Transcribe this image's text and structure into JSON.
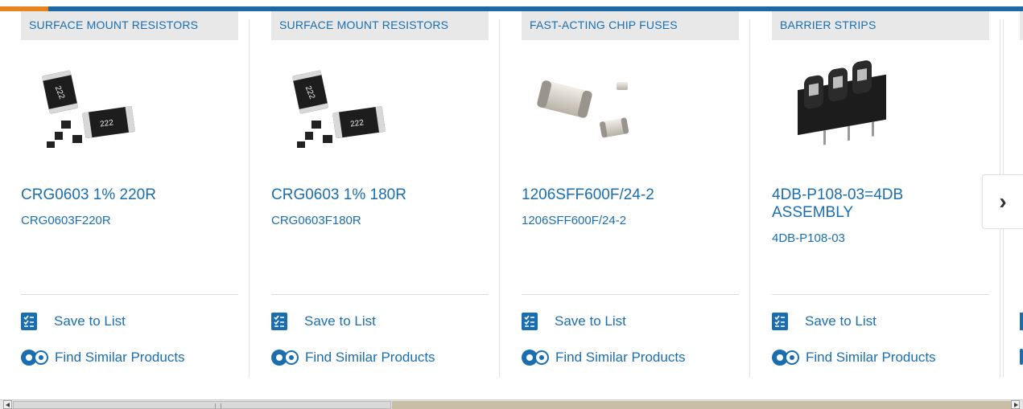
{
  "accent_color": "#1a6eb0",
  "top_accent_colors": {
    "bar": "#1b6aa5",
    "active": "#e9831f"
  },
  "actions": {
    "save": "Save to List",
    "similar": "Find Similar Products"
  },
  "products": [
    {
      "category": "SURFACE MOUNT RESISTORS",
      "name": "CRG0603 1% 220R",
      "part_number": "CRG0603F220R",
      "image": "chip-resistor-icon",
      "resistor_marking": "222"
    },
    {
      "category": "SURFACE MOUNT RESISTORS",
      "name": "CRG0603 1% 180R",
      "part_number": "CRG0603F180R",
      "image": "chip-resistor-icon",
      "resistor_marking": "222"
    },
    {
      "category": "FAST-ACTING CHIP FUSES",
      "name": "1206SFF600F/24-2",
      "part_number": "1206SFF600F/24-2",
      "image": "chip-fuse-icon"
    },
    {
      "category": "BARRIER STRIPS",
      "name": "4DB-P108-03=4DB ASSEMBLY",
      "part_number": "4DB-P108-03",
      "image": "barrier-strip-icon"
    }
  ],
  "next_button_glyph": "›"
}
